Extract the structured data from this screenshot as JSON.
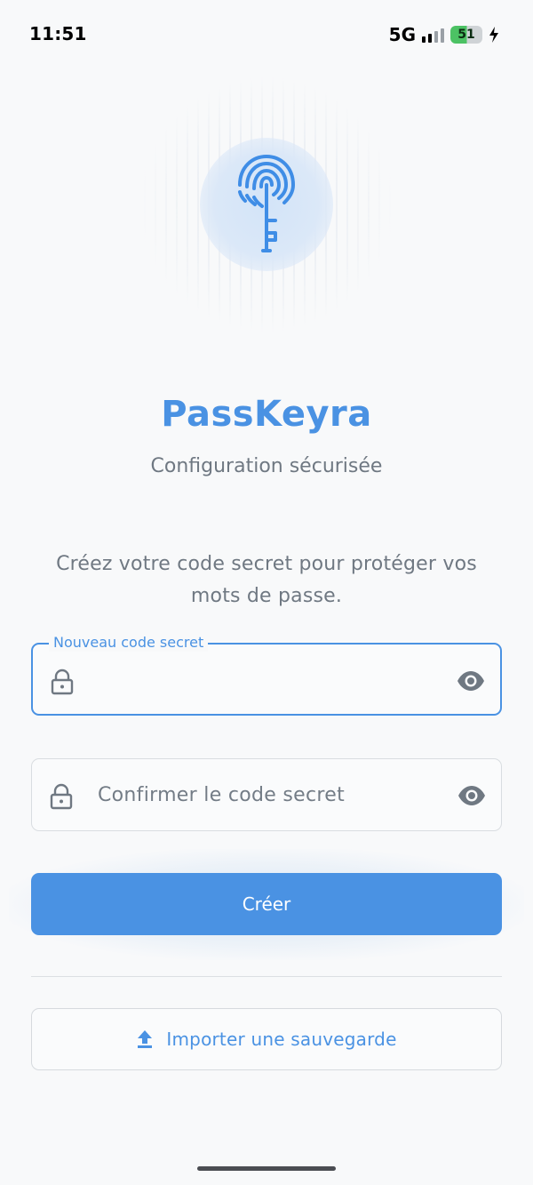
{
  "status_bar": {
    "time": "11:51",
    "network": "5G",
    "battery_percent": "51",
    "battery_level": 0.51
  },
  "app": {
    "title": "PassKeyra",
    "subtitle": "Configuration sécurisée",
    "logo_icon": "fingerprint-key-icon"
  },
  "intro_text": "Créez votre code secret pour protéger vos mots de passe.",
  "fields": {
    "new_code": {
      "label": "Nouveau code secret",
      "value": "",
      "placeholder": ""
    },
    "confirm_code": {
      "label": "",
      "value": "",
      "placeholder": "Confirmer le code secret"
    }
  },
  "buttons": {
    "create_label": "Créer",
    "import_label": "Importer une sauvegarde"
  },
  "colors": {
    "accent": "#4a92e3",
    "text_secondary": "#6f7882",
    "background": "#f8f9fa",
    "battery": "#4cc264"
  },
  "icons": [
    "lock-icon",
    "eye-icon",
    "upload-icon",
    "fingerprint-key-icon",
    "bolt-icon"
  ]
}
